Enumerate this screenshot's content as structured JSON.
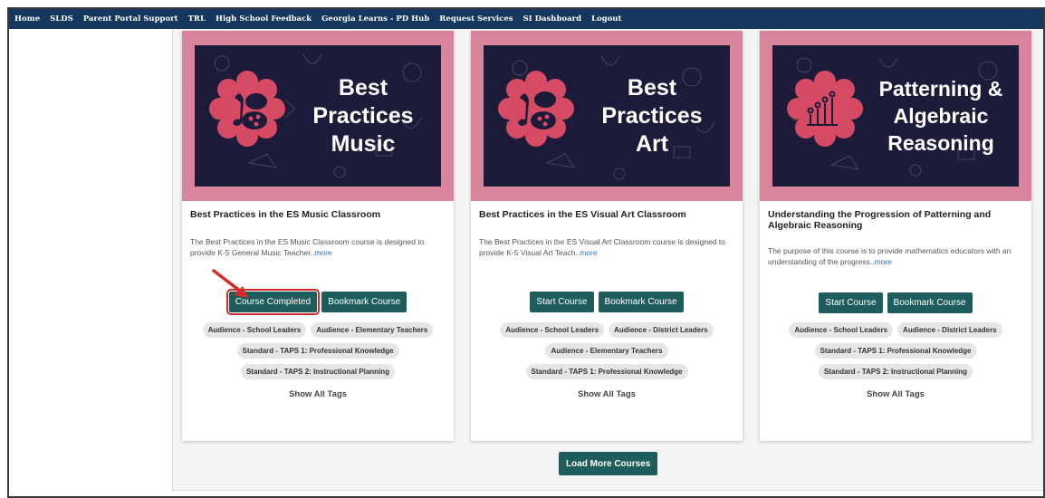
{
  "nav": {
    "items": [
      "Home",
      "SLDS",
      "Parent Portal Support",
      "TRL",
      "High School Feedback",
      "Georgia Learns - PD Hub",
      "Request Services",
      "SI Dashboard",
      "Logout"
    ]
  },
  "cards": [
    {
      "image_lines": [
        "Best",
        "Practices",
        "Music"
      ],
      "title": "Best Practices in the ES Music Classroom",
      "desc": "The Best Practices in the ES Music Classroom course is designed to provide K-5 General Music Teacher",
      "more": "..more",
      "primary_button": "Course Completed",
      "bookmark_button": "Bookmark Course",
      "tags": [
        [
          "Audience - School Leaders",
          "Audience - Elementary Teachers"
        ],
        [
          "Standard - TAPS 1: Professional Knowledge"
        ],
        [
          "Standard - TAPS 2: Instructional Planning"
        ]
      ],
      "show_tags": "Show All Tags"
    },
    {
      "image_lines": [
        "Best",
        "Practices",
        "Art"
      ],
      "title": "Best Practices in the ES Visual Art Classroom",
      "desc": "The Best Practices in the ES Visual Art Classroom course is designed to provide K-5 Visual Art Teach",
      "more": "..more",
      "primary_button": "Start Course",
      "bookmark_button": "Bookmark Course",
      "tags": [
        [
          "Audience - School Leaders",
          "Audience - District Leaders"
        ],
        [
          "Audience - Elementary Teachers"
        ],
        [
          "Standard - TAPS 1: Professional Knowledge"
        ]
      ],
      "show_tags": "Show All Tags"
    },
    {
      "image_lines": [
        "Patterning &",
        "Algebraic",
        "Reasoning"
      ],
      "title": "Understanding the Progression of Patterning and Algebraic Reasoning",
      "desc": "The purpose of this course is to provide mathematics educators with an understanding of the progress",
      "more": "..more",
      "primary_button": "Start Course",
      "bookmark_button": "Bookmark Course",
      "tags": [
        [
          "Audience - School Leaders",
          "Audience - District Leaders"
        ],
        [
          "Standard - TAPS 1: Professional Knowledge"
        ],
        [
          "Standard - TAPS 2: Instructional Planning"
        ]
      ],
      "show_tags": "Show All Tags"
    }
  ],
  "load_more": "Load More Courses",
  "colors": {
    "nav_bg": "#14375e",
    "button_bg": "#1f5c5c",
    "image_frame": "#d8849a",
    "highlight": "#d52b2b"
  },
  "icons": {
    "card_1_badge": "music-palette-icon",
    "card_2_badge": "theater-masks-palette-icon",
    "card_3_badge": "bar-pattern-icon",
    "annotation": "red-arrow-icon"
  }
}
